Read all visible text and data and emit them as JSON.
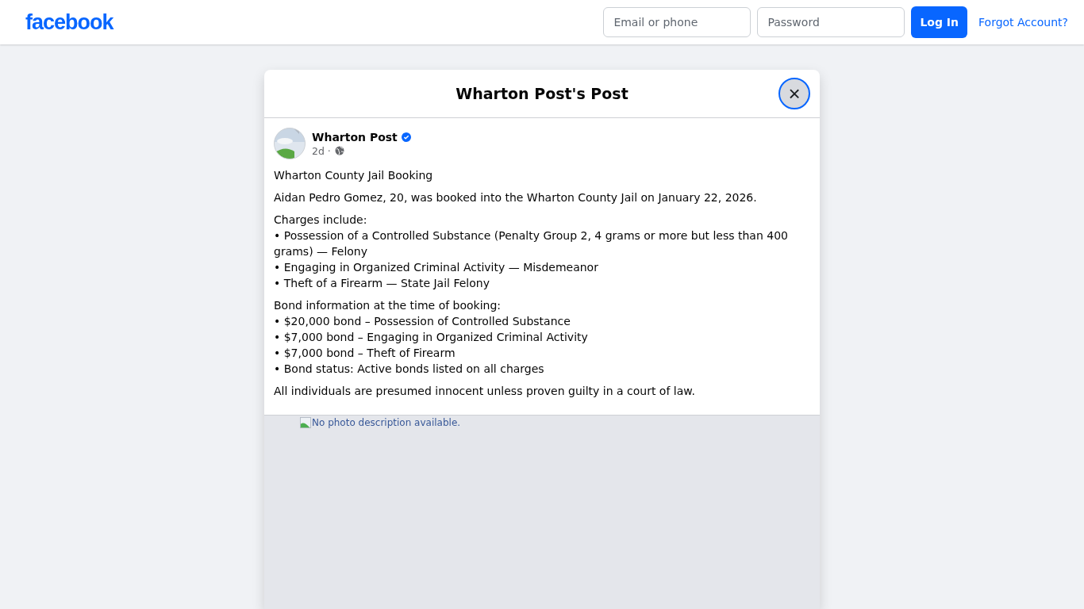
{
  "topbar": {
    "logo": "facebook",
    "email": {
      "placeholder": "Email or phone"
    },
    "password": {
      "placeholder": "Password"
    },
    "login_button": "Log In",
    "forgot_link": "Forgot Account?"
  },
  "dialog": {
    "title": "Wharton Post's Post",
    "close": "×"
  },
  "post": {
    "author": "Wharton Post",
    "verified": true,
    "time": "2d ·",
    "paragraphs": [
      [
        "Wharton County Jail Booking"
      ],
      [
        "Aidan Pedro Gomez, 20, was booked into the Wharton County Jail on January 22, 2026."
      ],
      [
        "Charges include:",
        "• Possession of a Controlled Substance (Penalty Group 2, 4 grams or more but less than 400 grams) — Felony",
        "• Engaging in Organized Criminal Activity — Misdemeanor",
        "• Theft of a Firearm — State Jail Felony"
      ],
      [
        "Bond information at the time of booking:",
        "• $20,000 bond – Possession of Controlled Substance",
        "• $7,000 bond – Engaging in Organized Criminal Activity",
        "• $7,000 bond – Theft of Firearm",
        "• Bond status: Active bonds listed on all charges"
      ],
      [
        "All individuals are presumed innocent unless proven guilty in a court of law."
      ]
    ],
    "image_alt": "No photo description available."
  }
}
